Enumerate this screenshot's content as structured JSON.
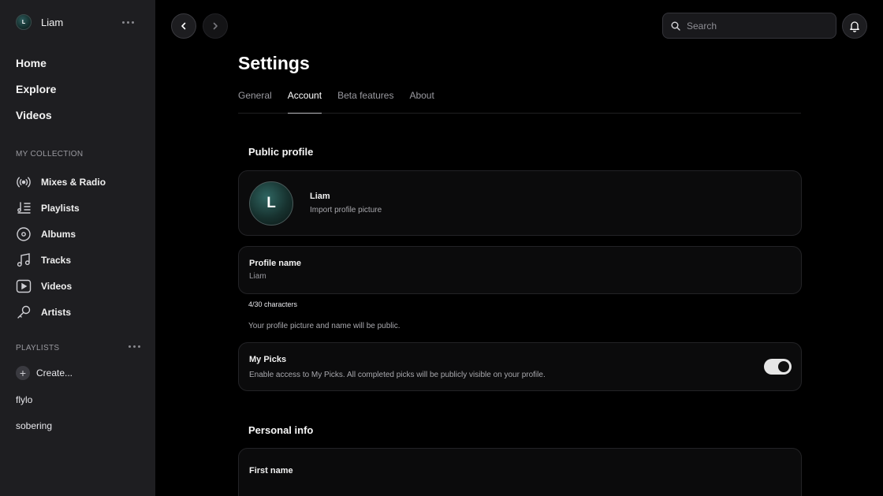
{
  "user": {
    "name": "Liam",
    "initial": "L"
  },
  "sidebar": {
    "main_nav": [
      {
        "label": "Home"
      },
      {
        "label": "Explore"
      },
      {
        "label": "Videos"
      }
    ],
    "collection_label": "MY COLLECTION",
    "collection_items": [
      {
        "label": "Mixes & Radio",
        "icon": "radio-icon"
      },
      {
        "label": "Playlists",
        "icon": "playlist-icon"
      },
      {
        "label": "Albums",
        "icon": "album-icon"
      },
      {
        "label": "Tracks",
        "icon": "music-note-icon"
      },
      {
        "label": "Videos",
        "icon": "video-icon"
      },
      {
        "label": "Artists",
        "icon": "microphone-icon"
      }
    ],
    "playlists_label": "PLAYLISTS",
    "create_label": "Create...",
    "playlists": [
      {
        "label": "flylo"
      },
      {
        "label": "sobering"
      }
    ]
  },
  "topbar": {
    "search_placeholder": "Search"
  },
  "settings": {
    "title": "Settings",
    "tabs": [
      {
        "label": "General",
        "active": false
      },
      {
        "label": "Account",
        "active": true
      },
      {
        "label": "Beta features",
        "active": false
      },
      {
        "label": "About",
        "active": false
      }
    ],
    "public_profile": {
      "heading": "Public profile",
      "name": "Liam",
      "import_label": "Import profile picture",
      "profile_name_label": "Profile name",
      "profile_name_value": "Liam",
      "char_count": "4/30 characters",
      "public_note": "Your profile picture and name will be public."
    },
    "my_picks": {
      "title": "My Picks",
      "description": "Enable access to My Picks. All completed picks will be publicly visible on your profile.",
      "enabled": true
    },
    "personal_info": {
      "heading": "Personal info",
      "first_name_label": "First name"
    }
  }
}
